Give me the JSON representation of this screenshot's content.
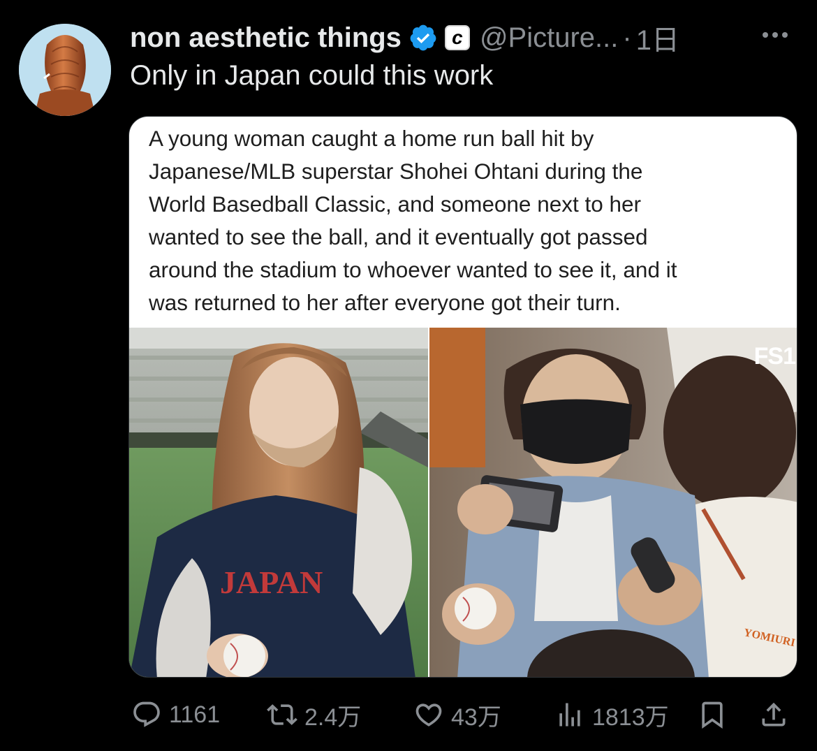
{
  "account": {
    "display_name": "non aesthetic things",
    "verified_icon": "verified-check-icon",
    "affiliate_badge": "c",
    "handle": "@Picture...",
    "separator": "·",
    "time": "1日"
  },
  "post": {
    "text": "Only in Japan could this work"
  },
  "media": {
    "caption": "A young woman caught a home run ball hit by\nJapanese/MLB superstar Shohei Ohtani during the\nWorld Basedball Classic, and someone next to her\nwanted to see the ball, and it eventually got passed\naround the stadium to whoever wanted to see it, and it\nwas returned to her after everyone got their turn.",
    "broadcast_logo": "FS1",
    "jersey_text": "JAPAN",
    "sleeve_text": "YOMIURI"
  },
  "actions": {
    "replies": "1161",
    "reposts": "2.4万",
    "likes": "43万",
    "views": "1813万"
  },
  "colors": {
    "background": "#000000",
    "text_primary": "#e7e9ea",
    "text_secondary": "#8b8f94",
    "verified_blue": "#1d9bf0"
  }
}
